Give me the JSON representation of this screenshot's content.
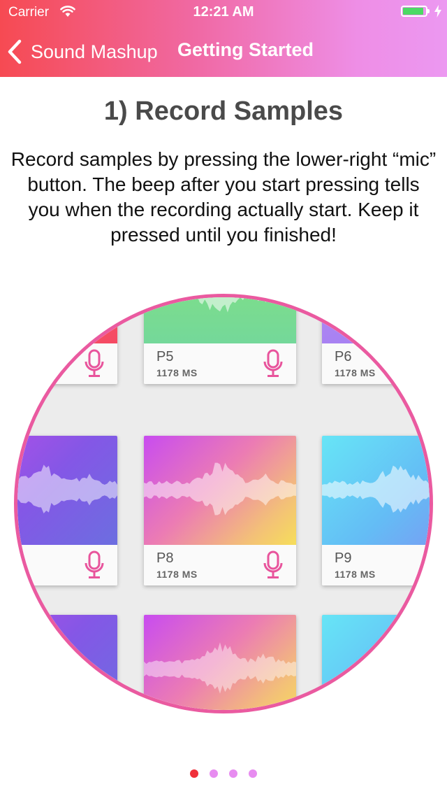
{
  "status_bar": {
    "carrier": "Carrier",
    "time": "12:21 AM",
    "battery_level": 0.9,
    "battery_color": "#4cd964"
  },
  "nav": {
    "back_label": "Sound Mashup",
    "title": "Getting Started",
    "back_icon": "chevron-left-icon"
  },
  "colors": {
    "header_gradient": [
      "#f64a52",
      "#f06aa6",
      "#ec98f1"
    ],
    "accent_pink": "#e8549c",
    "circle_border": "#ea5aa0",
    "dot_active": "#f0303a",
    "dot_inactive": "#e78cf0"
  },
  "step": {
    "title": "1) Record Samples",
    "description": "Record samples by pressing the lower-right “mic” button. The beep after you start pressing tells you when the recording actually start. Keep it pressed until you finished!"
  },
  "pads": [
    {
      "name": "P5",
      "duration": "1178 MS",
      "icon": "microphone-icon"
    },
    {
      "name": "P6",
      "duration": "1178 MS",
      "icon": "microphone-icon"
    },
    {
      "name": "P8",
      "duration": "1178 MS",
      "icon": "microphone-icon"
    },
    {
      "name": "P9",
      "duration": "1178 MS",
      "icon": "microphone-icon"
    }
  ],
  "pagination": {
    "total": 4,
    "current": 1
  }
}
